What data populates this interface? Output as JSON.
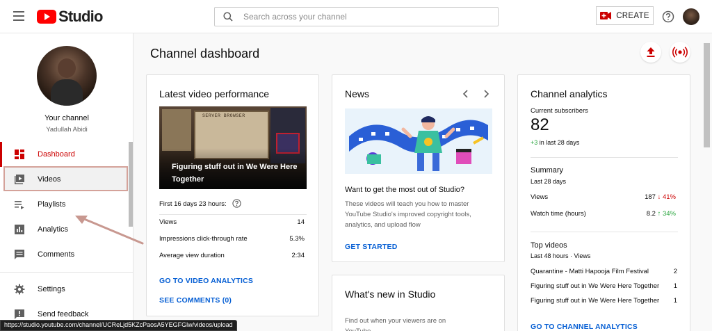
{
  "header": {
    "logo_text": "Studio",
    "search_placeholder": "Search across your channel",
    "create_label": "CREATE"
  },
  "sidebar": {
    "your_channel": "Your channel",
    "channel_name": "Yadullah Abidi",
    "items": [
      {
        "label": "Dashboard",
        "icon": "dashboard-icon",
        "active": true
      },
      {
        "label": "Videos",
        "icon": "videos-icon",
        "active": false
      },
      {
        "label": "Playlists",
        "icon": "playlists-icon",
        "active": false
      },
      {
        "label": "Analytics",
        "icon": "analytics-icon",
        "active": false
      },
      {
        "label": "Comments",
        "icon": "comments-icon",
        "active": false
      },
      {
        "label": "Settings",
        "icon": "gear-icon",
        "active": false
      },
      {
        "label": "Send feedback",
        "icon": "feedback-icon",
        "active": false
      }
    ]
  },
  "main": {
    "title": "Channel dashboard"
  },
  "latest_video": {
    "title": "Latest video performance",
    "thumb_caption": "SERVER BROWSER",
    "video_title": "Figuring stuff out in We Were Here Together",
    "period": "First 16 days 23 hours:",
    "stats": [
      {
        "label": "Views",
        "value": "14"
      },
      {
        "label": "Impressions click-through rate",
        "value": "5.3%"
      },
      {
        "label": "Average view duration",
        "value": "2:34"
      }
    ],
    "link_analytics": "GO TO VIDEO ANALYTICS",
    "link_comments": "SEE COMMENTS (0)"
  },
  "news": {
    "title": "News",
    "headline": "Want to get the most out of Studio?",
    "body": "These videos will teach you how to master YouTube Studio's improved copyright tools, analytics, and upload flow",
    "cta": "GET STARTED"
  },
  "whats_new": {
    "title": "What's new in Studio",
    "body": "Find out when your viewers are on YouTube"
  },
  "analytics": {
    "title": "Channel analytics",
    "subscribers_label": "Current subscribers",
    "subscribers": "82",
    "subscribers_change": "+3",
    "subscribers_change_period": "in last 28 days",
    "summary_title": "Summary",
    "summary_period": "Last 28 days",
    "summary_rows": [
      {
        "label": "Views",
        "value": "187",
        "arrow": "↓",
        "change": "41%",
        "trend": "down"
      },
      {
        "label": "Watch time (hours)",
        "value": "8.2",
        "arrow": "↑",
        "change": "34%",
        "trend": "up"
      }
    ],
    "top_title": "Top videos",
    "top_period": "Last 48 hours · Views",
    "top_videos": [
      {
        "title": "Quarantine - Matti Hapooja Film Festival",
        "views": "2"
      },
      {
        "title": "Figuring stuff out in We Were Here Together",
        "views": "1"
      },
      {
        "title": "Figuring stuff out in We Were Here Together",
        "views": "1"
      }
    ],
    "cta": "GO TO CHANNEL ANALYTICS"
  },
  "status_bar": {
    "url": "https://studio.youtube.com/channel/UCReLjd5KZcPaosA5YEGFGlw/videos/upload"
  },
  "colors": {
    "accent_red": "#cc0000",
    "link_blue": "#065fd4",
    "green": "#2ba640"
  }
}
